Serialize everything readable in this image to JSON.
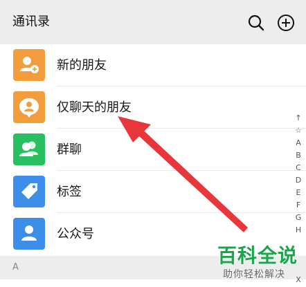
{
  "header": {
    "title": "通讯录",
    "search_icon": "search-icon",
    "add_icon": "add-icon"
  },
  "list": {
    "items": [
      {
        "label": "新的朋友",
        "icon": "add-friend-icon",
        "color": "#f39c3c"
      },
      {
        "label": "仅聊天的朋友",
        "icon": "chat-only-icon",
        "color": "#f39c3c"
      },
      {
        "label": "群聊",
        "icon": "group-icon",
        "color": "#27bf5f"
      },
      {
        "label": "标签",
        "icon": "tag-icon",
        "color": "#3d8ee8"
      },
      {
        "label": "公众号",
        "icon": "official-account-icon",
        "color": "#3d8ee8"
      }
    ]
  },
  "section": {
    "letter": "A"
  },
  "index_bar": {
    "items": [
      "↑",
      "☆",
      "A",
      "B",
      "C",
      "D",
      "E",
      "F",
      "G",
      "H"
    ],
    "bottom_item": "X"
  },
  "colors": {
    "header_bg": "#ededed",
    "arrow": "#e8373a"
  },
  "watermark": {
    "main": "百科全说",
    "sub": "助你轻松解决"
  }
}
